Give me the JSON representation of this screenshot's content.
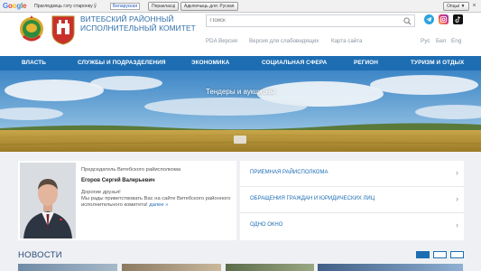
{
  "translate_bar": {
    "prompt_text": "Прагледзець гэту старонку ў",
    "source_language": "Беларуская",
    "translate_button": "Перакласці",
    "turn_off_button": "Адключыць для: Руская",
    "options_button": "Опцыі ▼",
    "close_label": "×"
  },
  "header": {
    "title": "ВИТЕБСКИЙ РАЙОННЫЙ ИСПОЛНИТЕЛЬНЫЙ КОМИТЕТ",
    "search_placeholder": "Поиск",
    "links": [
      "PDA Версия",
      "Версия для слабовидящих",
      "Карта сайта"
    ],
    "languages": [
      "Рус",
      "Бел",
      "Eng"
    ],
    "social_icons": [
      "telegram-icon",
      "instagram-icon",
      "tiktok-icon"
    ]
  },
  "nav": {
    "items": [
      "ВЛАСТЬ",
      "СЛУЖБЫ И ПОДРАЗДЕЛЕНИЯ",
      "ЭКОНОМИКА",
      "СОЦИАЛЬНАЯ СФЕРА",
      "РЕГИОН",
      "ТУРИЗМ И ОТДЫХ"
    ]
  },
  "banner": {
    "title": "Тендеры и аукционы"
  },
  "chairman": {
    "role": "Председатель Витебского райисполкома",
    "name": "Егоров Сергей Валерьевич",
    "greeting": "Дорогие друзья!",
    "welcome": "Мы рады приветствовать Вас на сайте Витебского районного исполнительного комитета!",
    "more_link": "далее »"
  },
  "quick_links": [
    {
      "label": "ПРИЕМНАЯ РАЙИСПОЛКОМА"
    },
    {
      "label": "ОБРАЩЕНИЯ ГРАЖДАН И ЮРИДИЧЕСКИХ ЛИЦ"
    },
    {
      "label": "ОДНО ОКНО"
    }
  ],
  "quick_arrow": "›",
  "news": {
    "title": "НОВОСТИ"
  },
  "colors": {
    "brand_blue": "#1d6db3",
    "title_blue": "#2f6fa9",
    "background": "#eef0f3"
  }
}
